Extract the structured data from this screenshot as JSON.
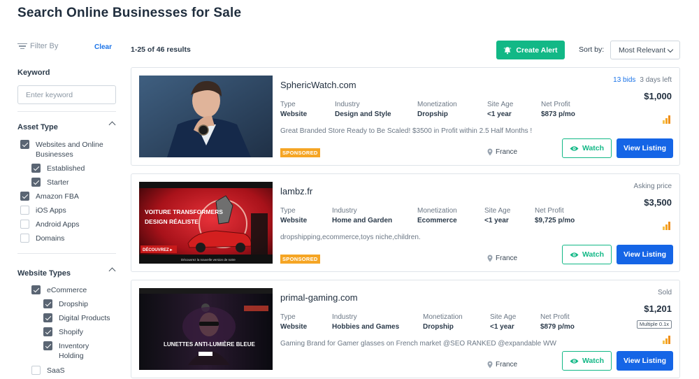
{
  "page": {
    "title": "Search Online Businesses for Sale"
  },
  "sidebar": {
    "filter_by": "Filter By",
    "clear": "Clear",
    "keyword": {
      "label": "Keyword",
      "placeholder": "Enter keyword"
    },
    "asset_type": {
      "label": "Asset Type",
      "options": [
        {
          "label": "Websites and Online Businesses",
          "checked": true
        },
        {
          "label": "Established",
          "checked": true
        },
        {
          "label": "Starter",
          "checked": true
        },
        {
          "label": "Amazon FBA",
          "checked": true
        },
        {
          "label": "iOS Apps",
          "checked": false
        },
        {
          "label": "Android Apps",
          "checked": false
        },
        {
          "label": "Domains",
          "checked": false
        }
      ]
    },
    "website_types": {
      "label": "Website Types",
      "options": [
        {
          "label": "eCommerce",
          "checked": true
        },
        {
          "label": "Dropship",
          "checked": true
        },
        {
          "label": "Digital Products",
          "checked": true
        },
        {
          "label": "Shopify",
          "checked": true
        },
        {
          "label": "Inventory Holding",
          "checked": true
        },
        {
          "label": "SaaS",
          "checked": false
        }
      ]
    }
  },
  "toolbar": {
    "results": "1-25 of 46 results",
    "create_alert": "Create Alert",
    "sort_label": "Sort by:",
    "sort_value": "Most Relevant"
  },
  "labels": {
    "type": "Type",
    "industry": "Industry",
    "monetization": "Monetization",
    "site_age": "Site Age",
    "net_profit": "Net Profit",
    "watch": "Watch",
    "view_listing": "View Listing",
    "sponsored": "SPONSORED"
  },
  "listings": [
    {
      "title": "SphericWatch.com",
      "type": "Website",
      "industry": "Design and Style",
      "monetization": "Dropship",
      "site_age": "<1 year",
      "net_profit": "$873 p/mo",
      "description": "Great Branded Store Ready to Be Scaled! $3500 in Profit within 2.5 Half Months !",
      "sponsored": true,
      "location": "France",
      "bids": "13 bids",
      "time_left": "3 days left",
      "price": "$1,000"
    },
    {
      "title": "lambz.fr",
      "type": "Website",
      "industry": "Home and Garden",
      "monetization": "Ecommerce",
      "site_age": "<1 year",
      "net_profit": "$9,725 p/mo",
      "description": "dropshipping,ecommerce,toys niche,children.",
      "sponsored": true,
      "location": "France",
      "status": "Asking price",
      "price": "$3,500",
      "thumb_text": {
        "headline1": "VOITURE TRANSFORMERS",
        "headline2": "DESIGN RÉALISTE",
        "cta": "DÉCOUVREZ ▸",
        "caption": "Découvrez la nouvelle version de notre"
      }
    },
    {
      "title": "primal-gaming.com",
      "type": "Website",
      "industry": "Hobbies and Games",
      "monetization": "Dropship",
      "site_age": "<1 year",
      "net_profit": "$879 p/mo",
      "description": "Gaming Brand for Gamer glasses on French market @SEO RANKED @expandable WW",
      "sponsored": false,
      "location": "France",
      "status": "Sold",
      "price": "$1,201",
      "multiple": "Multiple 0.1x",
      "thumb_text": {
        "headline": "LUNETTES ANTI-LUMIÈRE BLEUE"
      }
    }
  ],
  "colors": {
    "accent_green": "#12b886",
    "primary_blue": "#1565e6",
    "sponsored": "#f5a524"
  }
}
